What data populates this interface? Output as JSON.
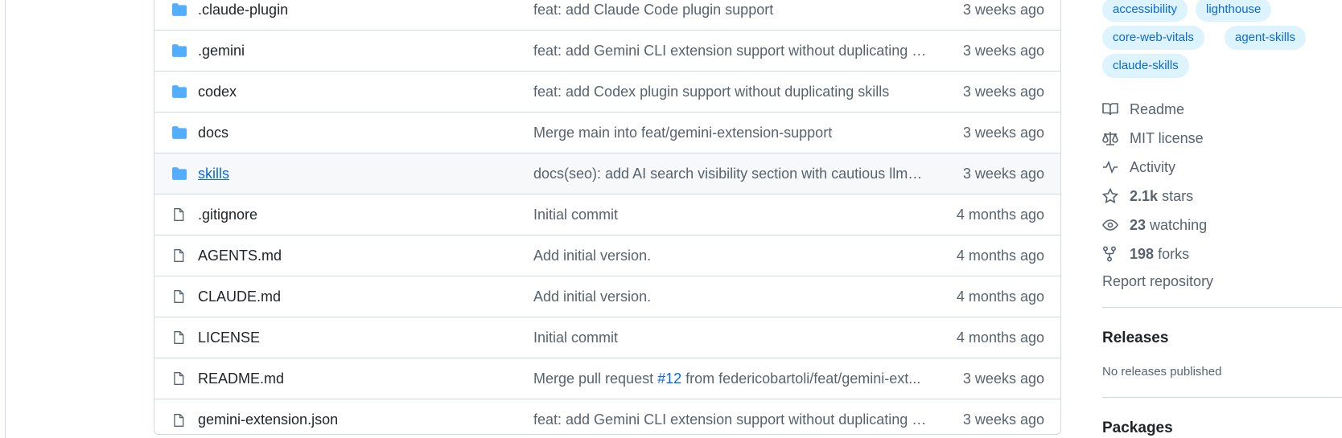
{
  "file_table": {
    "rows": [
      {
        "type": "folder",
        "name": ".claude-plugin",
        "message": "feat: add Claude Code plugin support",
        "age": "3 weeks ago"
      },
      {
        "type": "folder",
        "name": ".gemini",
        "message": "feat: add Gemini CLI extension support without duplicating s...",
        "age": "3 weeks ago"
      },
      {
        "type": "folder",
        "name": "codex",
        "message": "feat: add Codex plugin support without duplicating skills",
        "age": "3 weeks ago"
      },
      {
        "type": "folder",
        "name": "docs",
        "message": "Merge main into feat/gemini-extension-support",
        "age": "3 weeks ago"
      },
      {
        "type": "folder",
        "name": "skills",
        "message": "docs(seo): add AI search visibility section with cautious llms.tx...",
        "age": "3 weeks ago"
      },
      {
        "type": "file",
        "name": ".gitignore",
        "message": "Initial commit",
        "age": "4 months ago"
      },
      {
        "type": "file",
        "name": "AGENTS.md",
        "message": "Add initial version.",
        "age": "4 months ago"
      },
      {
        "type": "file",
        "name": "CLAUDE.md",
        "message": "Add initial version.",
        "age": "4 months ago"
      },
      {
        "type": "file",
        "name": "LICENSE",
        "message": "Initial commit",
        "age": "4 months ago"
      },
      {
        "type": "file",
        "name": "README.md",
        "message_prefix": "Merge pull request ",
        "message_link": "#12",
        "message_suffix": " from federicobartoli/feat/gemini-ext...",
        "age": "3 weeks ago"
      },
      {
        "type": "file",
        "name": "gemini-extension.json",
        "message": "feat: add Gemini CLI extension support without duplicating s...",
        "age": "3 weeks ago"
      }
    ]
  },
  "sidebar": {
    "topics": [
      "accessibility",
      "lighthouse",
      "core-web-vitals",
      "agent-skills",
      "claude-skills"
    ],
    "about": {
      "readme": "Readme",
      "license": "MIT license",
      "activity": "Activity",
      "stars_count": "2.1k",
      "stars_label": "stars",
      "watching_count": "23",
      "watching_label": "watching",
      "forks_count": "198",
      "forks_label": "forks"
    },
    "report": "Report repository",
    "releases_title": "Releases",
    "releases_text": "No releases published",
    "packages_title": "Packages"
  },
  "colors": {
    "accent": "#0969da",
    "folder_icon": "#54aeff",
    "muted": "#59636e",
    "topic_bg": "#ddf4ff"
  },
  "icons": {
    "folder": "folder-icon",
    "file": "file-icon"
  }
}
